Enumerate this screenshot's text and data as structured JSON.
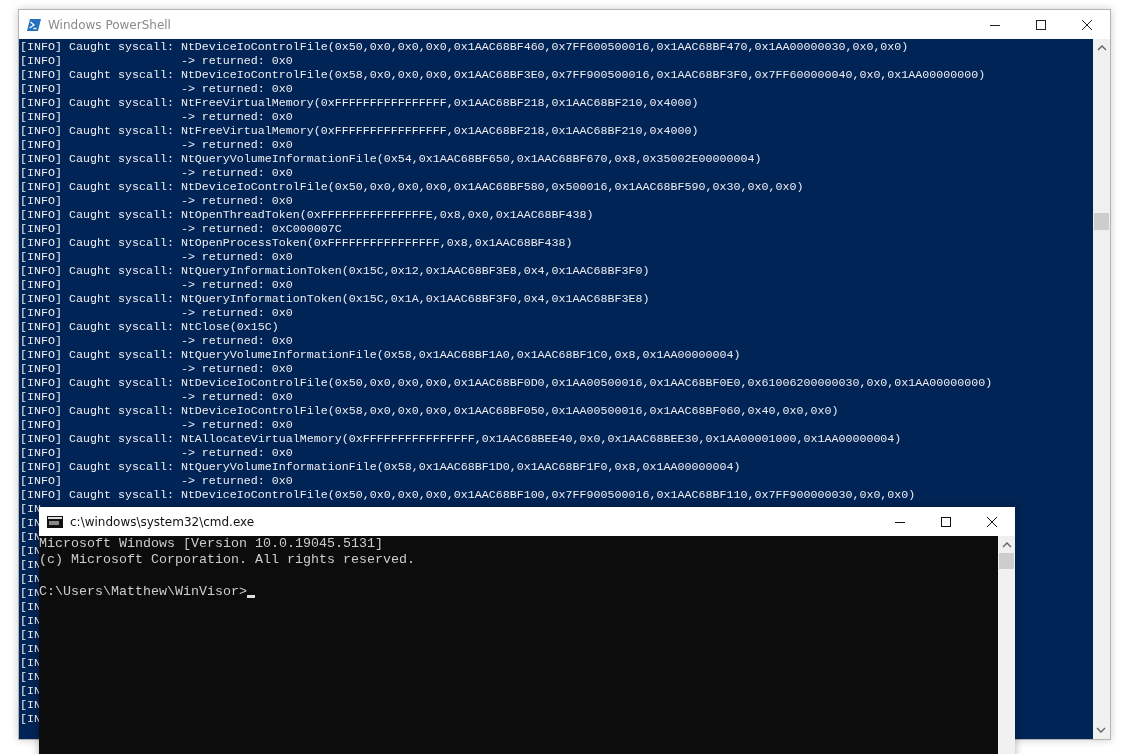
{
  "powershell": {
    "title": "Windows PowerShell",
    "lines": [
      "[INFO] Caught syscall: NtDeviceIoControlFile(0x50,0x0,0x0,0x0,0x1AAC68BF460,0x7FF600500016,0x1AAC68BF470,0x1AA00000030,0x0,0x0)",
      "[INFO]                 -> returned: 0x0",
      "[INFO] Caught syscall: NtDeviceIoControlFile(0x58,0x0,0x0,0x0,0x1AAC68BF3E0,0x7FF900500016,0x1AAC68BF3F0,0x7FF600000040,0x0,0x1AA00000000)",
      "[INFO]                 -> returned: 0x0",
      "[INFO] Caught syscall: NtFreeVirtualMemory(0xFFFFFFFFFFFFFFFF,0x1AAC68BF218,0x1AAC68BF210,0x4000)",
      "[INFO]                 -> returned: 0x0",
      "[INFO] Caught syscall: NtFreeVirtualMemory(0xFFFFFFFFFFFFFFFF,0x1AAC68BF218,0x1AAC68BF210,0x4000)",
      "[INFO]                 -> returned: 0x0",
      "[INFO] Caught syscall: NtQueryVolumeInformationFile(0x54,0x1AAC68BF650,0x1AAC68BF670,0x8,0x35002E00000004)",
      "[INFO]                 -> returned: 0x0",
      "[INFO] Caught syscall: NtDeviceIoControlFile(0x50,0x0,0x0,0x0,0x1AAC68BF580,0x500016,0x1AAC68BF590,0x30,0x0,0x0)",
      "[INFO]                 -> returned: 0x0",
      "[INFO] Caught syscall: NtOpenThreadToken(0xFFFFFFFFFFFFFFFE,0x8,0x0,0x1AAC68BF438)",
      "[INFO]                 -> returned: 0xC000007C",
      "[INFO] Caught syscall: NtOpenProcessToken(0xFFFFFFFFFFFFFFFF,0x8,0x1AAC68BF438)",
      "[INFO]                 -> returned: 0x0",
      "[INFO] Caught syscall: NtQueryInformationToken(0x15C,0x12,0x1AAC68BF3E8,0x4,0x1AAC68BF3F0)",
      "[INFO]                 -> returned: 0x0",
      "[INFO] Caught syscall: NtQueryInformationToken(0x15C,0x1A,0x1AAC68BF3F0,0x4,0x1AAC68BF3E8)",
      "[INFO]                 -> returned: 0x0",
      "[INFO] Caught syscall: NtClose(0x15C)",
      "[INFO]                 -> returned: 0x0",
      "[INFO] Caught syscall: NtQueryVolumeInformationFile(0x58,0x1AAC68BF1A0,0x1AAC68BF1C0,0x8,0x1AA00000004)",
      "[INFO]                 -> returned: 0x0",
      "[INFO] Caught syscall: NtDeviceIoControlFile(0x50,0x0,0x0,0x0,0x1AAC68BF0D0,0x1AA00500016,0x1AAC68BF0E0,0x61006200000030,0x0,0x1AA00000000)",
      "[INFO]                 -> returned: 0x0",
      "[INFO] Caught syscall: NtDeviceIoControlFile(0x58,0x0,0x0,0x0,0x1AAC68BF050,0x1AA00500016,0x1AAC68BF060,0x40,0x0,0x0)",
      "[INFO]                 -> returned: 0x0",
      "[INFO] Caught syscall: NtAllocateVirtualMemory(0xFFFFFFFFFFFFFFFF,0x1AAC68BEE40,0x0,0x1AAC68BEE30,0x1AA00001000,0x1AA00000004)",
      "[INFO]                 -> returned: 0x0",
      "[INFO] Caught syscall: NtQueryVolumeInformationFile(0x58,0x1AAC68BF1D0,0x1AAC68BF1F0,0x8,0x1AA00000004)",
      "[INFO]                 -> returned: 0x0",
      "[INFO] Caught syscall: NtDeviceIoControlFile(0x50,0x0,0x0,0x0,0x1AAC68BF100,0x7FF900500016,0x1AAC68BF110,0x7FF900000030,0x0,0x0)",
      "[IN",
      "[IN",
      "[IN",
      "[IN",
      "[IN",
      "[IN",
      "[IN",
      "[IN",
      "[IN",
      "[IN",
      "[IN",
      "[IN",
      "[IN",
      "[IN",
      "[IN",
      "[IN"
    ]
  },
  "cmd": {
    "title": "c:\\windows\\system32\\cmd.exe",
    "lines": [
      "Microsoft Windows [Version 10.0.19045.5131]",
      "(c) Microsoft Corporation. All rights reserved."
    ],
    "prompt": "C:\\Users\\Matthew\\WinVisor>"
  }
}
